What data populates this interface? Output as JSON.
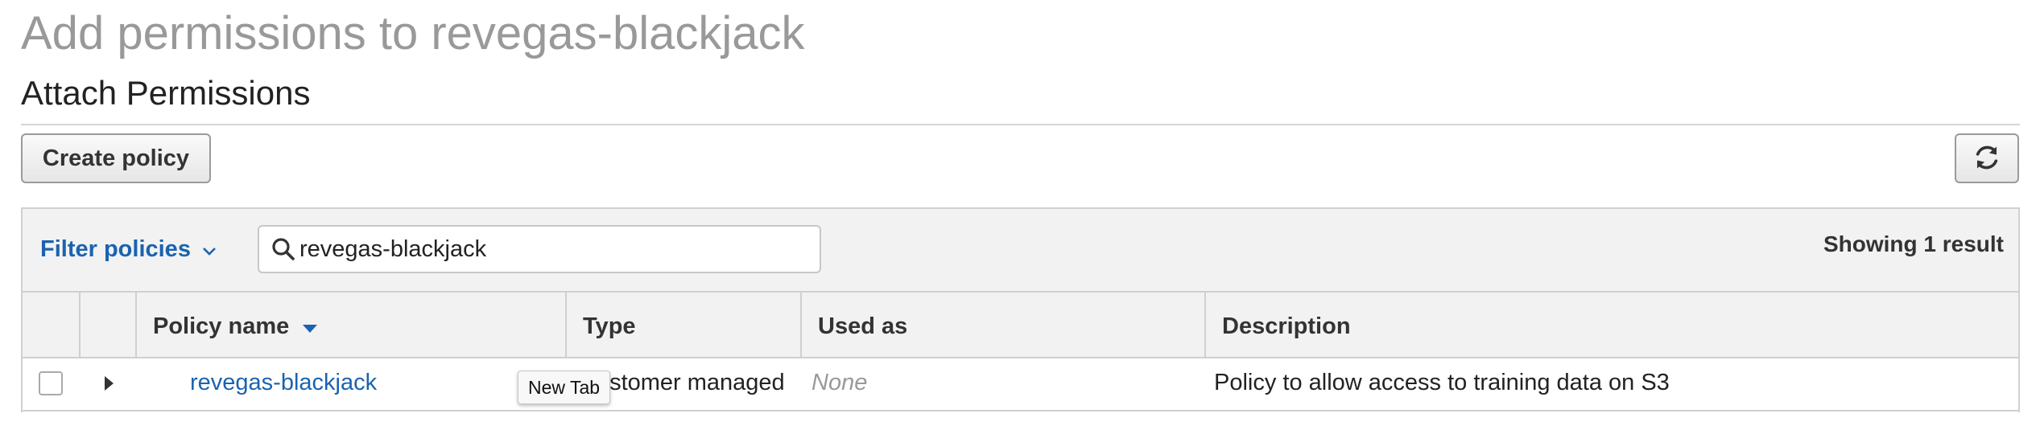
{
  "page": {
    "title": "Add permissions to revegas-blackjack",
    "section_title": "Attach Permissions"
  },
  "toolbar": {
    "create_label": "Create policy",
    "refresh_icon": "refresh-icon"
  },
  "filter": {
    "label": "Filter policies",
    "search_value": "revegas-blackjack",
    "result_count": "Showing 1 result"
  },
  "table": {
    "columns": [
      "Policy name",
      "Type",
      "Used as",
      "Description"
    ],
    "sort_column": "Policy name",
    "rows": [
      {
        "name": "revegas-blackjack",
        "type": "Customer managed",
        "used_as": "None",
        "description": "Policy to allow access to training data on S3"
      }
    ]
  },
  "tooltip": {
    "text": "New Tab"
  },
  "colors": {
    "link": "#1a63b0",
    "header_bg": "#f2f2f2",
    "muted": "#999999"
  }
}
